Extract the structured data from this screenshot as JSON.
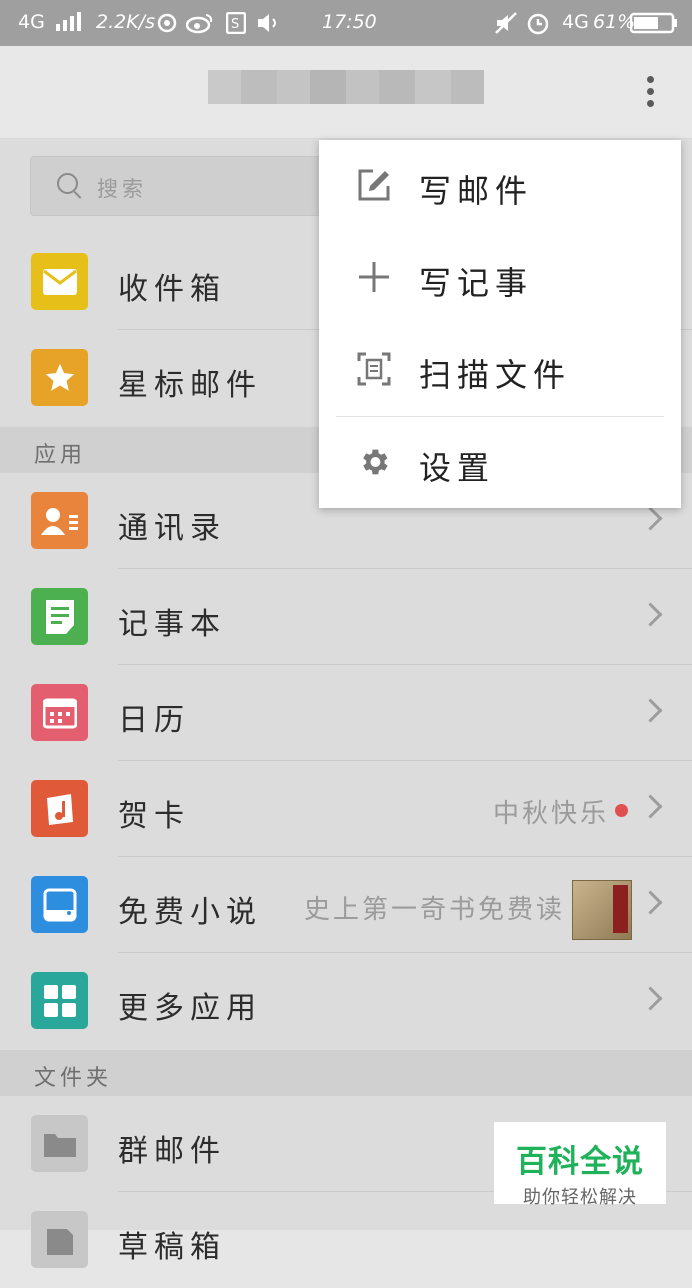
{
  "status_bar": {
    "network": "4G",
    "speed": "2.2K/s",
    "time": "17:50",
    "network_right": "4G",
    "battery": "61%"
  },
  "search": {
    "placeholder": "搜索"
  },
  "top_items": [
    {
      "label": "收件箱",
      "icon": "inbox-envelope-icon",
      "color": "#e6c019"
    },
    {
      "label": "星标邮件",
      "icon": "star-icon",
      "color": "#e7a328"
    }
  ],
  "sections": {
    "apps": "应用",
    "folders": "文件夹"
  },
  "apps": [
    {
      "label": "通讯录",
      "icon": "contacts-icon",
      "color": "#e8843b",
      "note": ""
    },
    {
      "label": "记事本",
      "icon": "notebook-icon",
      "color": "#4caf50",
      "note": ""
    },
    {
      "label": "日历",
      "icon": "calendar-icon",
      "color": "#e35e6e",
      "note": ""
    },
    {
      "label": "贺卡",
      "icon": "greeting-card-icon",
      "color": "#e05a3a",
      "note": "中秋快乐"
    },
    {
      "label": "免费小说",
      "icon": "novel-icon",
      "color": "#2d8ee0",
      "note": "史上第一奇书免费读"
    },
    {
      "label": "更多应用",
      "icon": "more-apps-icon",
      "color": "#2aa79b",
      "note": ""
    }
  ],
  "folders": [
    {
      "label": "群邮件",
      "icon": "folder-icon",
      "color": "#c7c7c7"
    },
    {
      "label": "草稿箱",
      "icon": "drafts-icon",
      "color": "#c7c7c7"
    }
  ],
  "menu": {
    "items": [
      {
        "label": "写邮件",
        "icon": "compose-icon"
      },
      {
        "label": "写记事",
        "icon": "plus-icon"
      },
      {
        "label": "扫描文件",
        "icon": "scan-icon"
      },
      {
        "label": "设置",
        "icon": "gear-icon"
      }
    ]
  },
  "watermark": {
    "title": "百科全说",
    "subtitle": "助你轻松解决"
  }
}
